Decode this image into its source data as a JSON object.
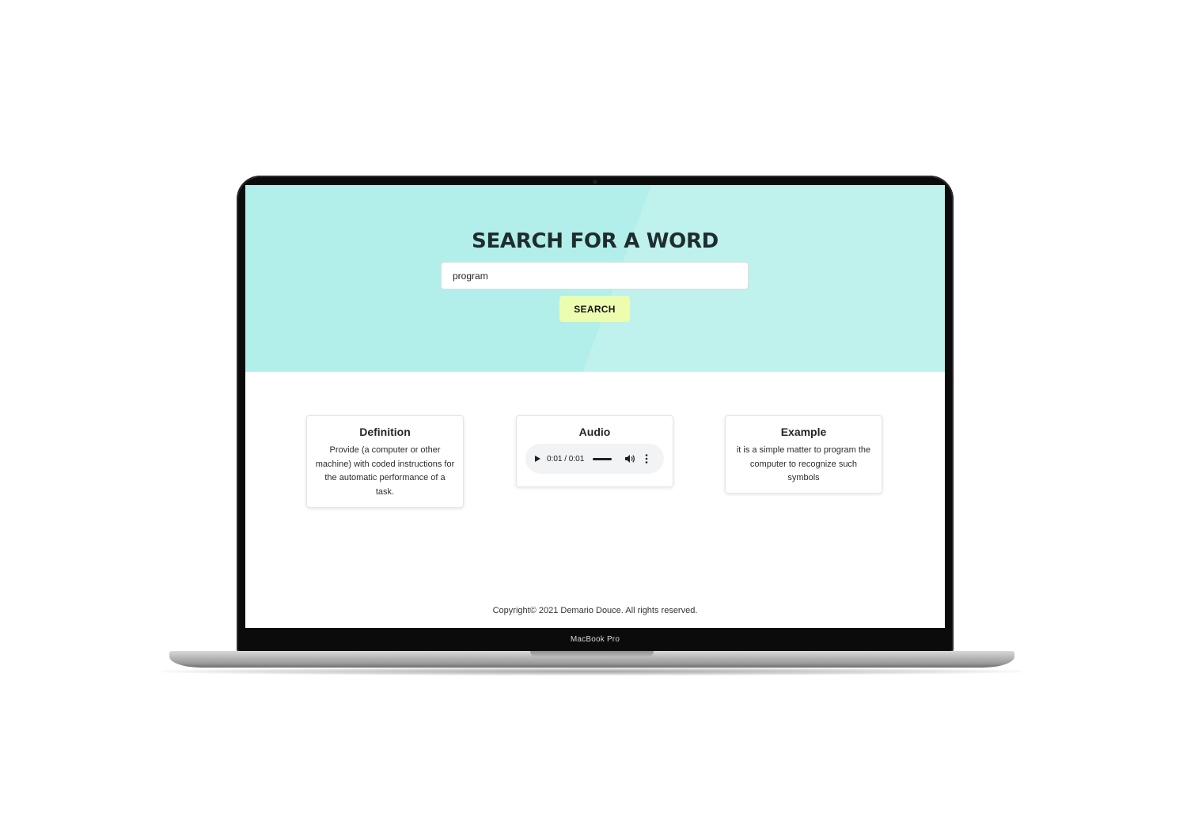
{
  "hero": {
    "title": "SEARCH FOR A WORD",
    "search_value": "program",
    "search_button_label": "SEARCH",
    "background_color": "#b3efea",
    "button_color": "#edfdb0"
  },
  "cards": {
    "definition": {
      "title": "Definition",
      "text": "Provide (a computer or other machine) with coded instructions for the automatic performance of a task."
    },
    "audio": {
      "title": "Audio",
      "time": "0:01 / 0:01",
      "progress_fraction": 1.0,
      "icons": [
        "play-icon",
        "volume-icon",
        "more-options-icon"
      ]
    },
    "example": {
      "title": "Example",
      "text": "it is a simple matter to program the computer to recognize such symbols"
    }
  },
  "footer": {
    "text": "Copyright© 2021 Demario Douce. All rights reserved."
  },
  "device": {
    "label": "MacBook Pro"
  }
}
